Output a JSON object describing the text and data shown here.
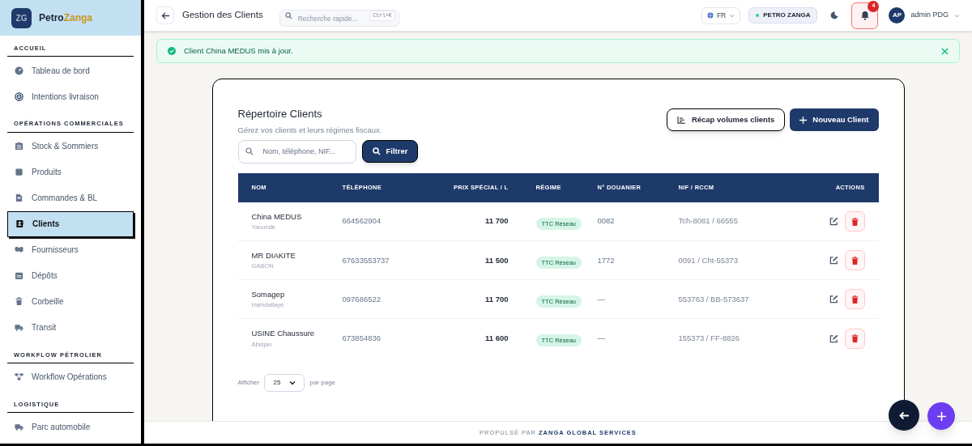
{
  "brand": {
    "part_1": "Petro",
    "part_2": "Zanga",
    "logo_text": "ZG"
  },
  "sidebar": {
    "sections": [
      {
        "title": "ACCUEIL",
        "items": [
          {
            "label": "Tableau de bord",
            "selected": false
          },
          {
            "label": "Intentions livraison",
            "selected": false
          }
        ]
      },
      {
        "title": "OPÉRATIONS COMMERCIALES",
        "items": [
          {
            "label": "Stock & Sommiers",
            "selected": false
          },
          {
            "label": "Produits",
            "selected": false
          },
          {
            "label": "Commandes & BL",
            "selected": false
          },
          {
            "label": "Clients",
            "selected": true
          },
          {
            "label": "Fournisseurs",
            "selected": false
          },
          {
            "label": "Dépôts",
            "selected": false
          },
          {
            "label": "Corbeille",
            "selected": false
          },
          {
            "label": "Transit",
            "selected": false
          }
        ]
      },
      {
        "title": "WORKFLOW PÉTROLIER",
        "items": [
          {
            "label": "Workflow Opérations",
            "selected": false
          }
        ]
      },
      {
        "title": "LOGISTIQUE",
        "items": [
          {
            "label": "Parc automobile",
            "selected": false
          }
        ]
      }
    ]
  },
  "header": {
    "title": "Gestion des Clients",
    "search": {
      "placeholder": "Recherche rapide...",
      "shortcut": "Ctrl+K"
    },
    "language": "FR",
    "company": "PETRO ZANGA",
    "notifications": "4",
    "user": {
      "initials": "AP",
      "name": "admin PDG"
    }
  },
  "toast": {
    "message": "Client China MEDUS mis à jour."
  },
  "card": {
    "title": "Répertoire Clients",
    "subtitle": "Gérez vos clients et leurs régimes fiscaux.",
    "buttons": [
      "Récap volumes clients",
      "Nouveau Client"
    ],
    "search": {
      "placeholder": "Nom, téléphone, NIF..."
    },
    "filter_button": "Filtrer"
  },
  "table": {
    "columns": [
      "NOM",
      "TÉLÉPHONE",
      "PRIX SPÉCIAL / L",
      "RÉGIME",
      "N° DOUANIER",
      "NIF / RCCM",
      "ACTIONS"
    ],
    "rows": [
      {
        "name": "China MEDUS",
        "city": "Yaounde",
        "phone": "664562904",
        "price": "11 700",
        "regime": "TTC Réseau",
        "customs": "0082",
        "nif": "Tch-8081 / 66555"
      },
      {
        "name": "MR DIAKITE",
        "city": "GABON",
        "phone": "67633553737",
        "price": "11 500",
        "regime": "TTC Réseau",
        "customs": "1772",
        "nif": "0091 / Cht-55373"
      },
      {
        "name": "Somagep",
        "city": "Hamdallaye",
        "phone": "097686522",
        "price": "11 700",
        "regime": "TTC Réseau",
        "customs": "—",
        "nif": "553763 / BB-573637"
      },
      {
        "name": "USINE Chaussure",
        "city": "Abidjan",
        "phone": "673854836",
        "price": "11 600",
        "regime": "TTC Réseau",
        "customs": "—",
        "nif": "155373 / FF-8826"
      }
    ]
  },
  "pagination": {
    "label_before": "Afficher",
    "page_size": "25",
    "label_after": "par page"
  },
  "footer": {
    "prefix": "PROPULSÉ PAR",
    "company": "ZANGA GLOBAL SERVICES"
  }
}
